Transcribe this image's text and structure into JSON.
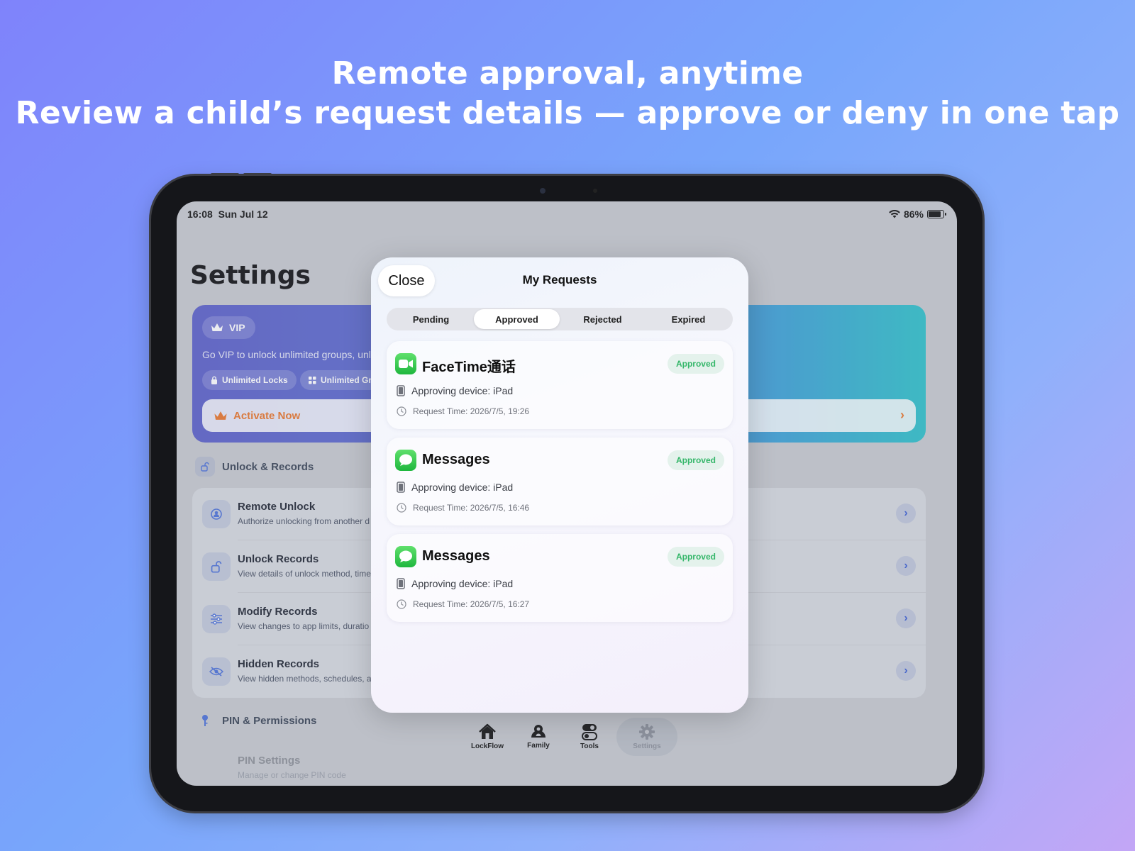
{
  "headline": {
    "line1": "Remote approval, anytime",
    "line2": "Review a child’s request details — approve or deny in one tap"
  },
  "status_bar": {
    "time": "16:08",
    "date": "Sun Jul 12",
    "battery": "86%",
    "battery_level": 0.86
  },
  "settings": {
    "title": "Settings",
    "vip": {
      "badge": "VIP",
      "description": "Go VIP to unlock unlimited groups, unli",
      "features": [
        "Unlimited Locks",
        "Unlimited Gr"
      ],
      "activate": "Activate Now"
    },
    "section_unlock": "Unlock & Records",
    "rows": [
      {
        "title": "Remote Unlock",
        "subtitle": "Authorize unlocking from another d"
      },
      {
        "title": "Unlock Records",
        "subtitle": "View details of unlock method, time"
      },
      {
        "title": "Modify Records",
        "subtitle": "View changes to app limits, duratio"
      },
      {
        "title": "Hidden Records",
        "subtitle": "View hidden methods, schedules, a"
      }
    ],
    "section_pin": "PIN & Permissions",
    "pin_row": {
      "title": "PIN Settings",
      "subtitle": "Manage or change PIN code"
    }
  },
  "tabbar": {
    "items": [
      {
        "label": "LockFlow",
        "icon": "house-icon"
      },
      {
        "label": "Family",
        "icon": "family-icon"
      },
      {
        "label": "Tools",
        "icon": "toggles-icon"
      },
      {
        "label": "Settings",
        "icon": "gear-icon"
      }
    ],
    "active": "Settings"
  },
  "modal": {
    "close": "Close",
    "title": "My Requests",
    "segments": [
      "Pending",
      "Approved",
      "Rejected",
      "Expired"
    ],
    "active_segment": "Approved",
    "requests": [
      {
        "app": "FaceTime通话",
        "icon": "facetime-icon",
        "status": "Approved",
        "device": "Approving device: iPad",
        "time": "Request Time: 2026/7/5, 19:26"
      },
      {
        "app": "Messages",
        "icon": "messages-icon",
        "status": "Approved",
        "device": "Approving device: iPad",
        "time": "Request Time: 2026/7/5, 16:46"
      },
      {
        "app": "Messages",
        "icon": "messages-icon",
        "status": "Approved",
        "device": "Approving device: iPad",
        "time": "Request Time: 2026/7/5, 16:27"
      }
    ]
  },
  "colors": {
    "approved_badge": "#35b76a",
    "activate_accent": "#e8752a",
    "chevron": "#3b5fd4"
  }
}
